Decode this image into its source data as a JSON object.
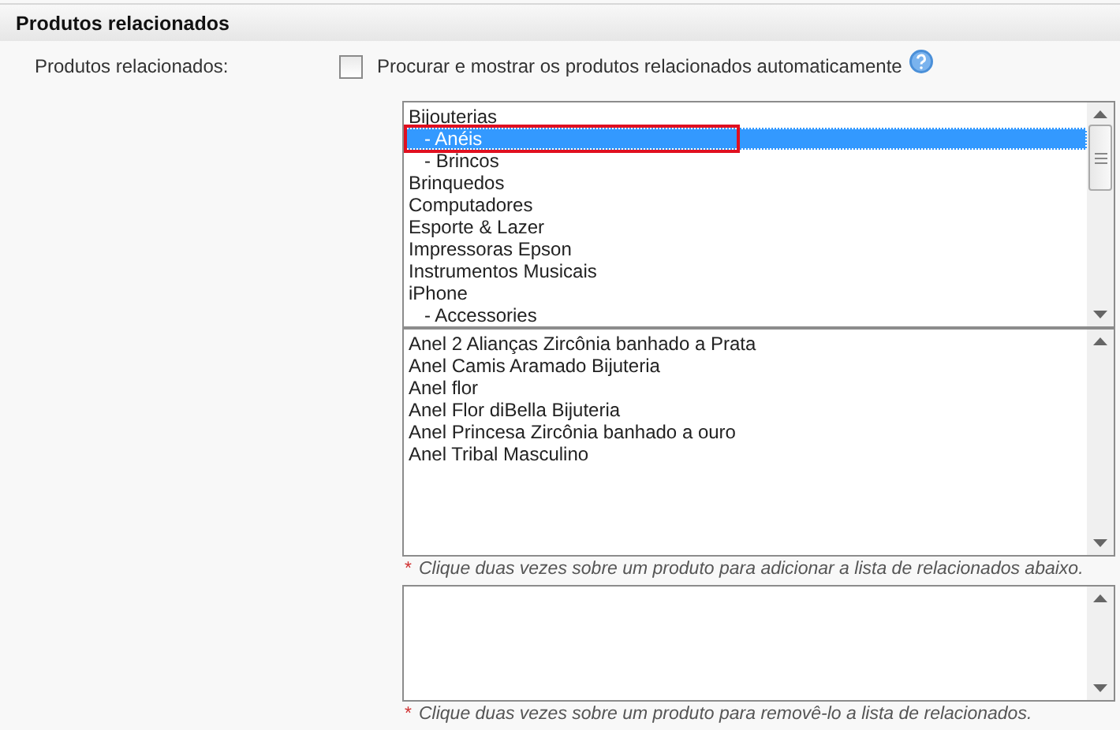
{
  "section": {
    "title": "Produtos relacionados"
  },
  "field": {
    "label": "Produtos relacionados:",
    "checkbox": {
      "label": "Procurar e mostrar os produtos relacionados automaticamente",
      "checked": false
    }
  },
  "categories": [
    {
      "label": "Bijouterias",
      "selected": false,
      "annotated": false,
      "children": [
        {
          "label": "- Anéis",
          "selected": true,
          "annotated": true
        },
        {
          "label": "- Brincos",
          "selected": false,
          "annotated": false
        }
      ]
    },
    {
      "label": "Brinquedos",
      "selected": false,
      "annotated": false
    },
    {
      "label": "Computadores",
      "selected": false,
      "annotated": false
    },
    {
      "label": "Esporte & Lazer",
      "selected": false,
      "annotated": false
    },
    {
      "label": "Impressoras Epson",
      "selected": false,
      "annotated": false
    },
    {
      "label": "Instrumentos Musicais",
      "selected": false,
      "annotated": false
    },
    {
      "label": "iPhone",
      "selected": false,
      "annotated": false,
      "children": [
        {
          "label": "- Accessories",
          "selected": false,
          "annotated": false
        }
      ]
    }
  ],
  "products": [
    {
      "label": "Anel 2 Alianças Zircônia banhado a Prata",
      "selected": false
    },
    {
      "label": "Anel Camis Aramado Bijuteria",
      "selected": false
    },
    {
      "label": "Anel flor",
      "selected": false
    },
    {
      "label": "Anel Flor diBella Bijuteria",
      "selected": false
    },
    {
      "label": "Anel Princesa Zircônia banhado a ouro",
      "selected": false
    },
    {
      "label": "Anel Tribal Masculino",
      "selected": false
    }
  ],
  "products_note": {
    "mark": "*",
    "text": "Clique duas vezes sobre um produto para adicionar a lista de relacionados abaixo."
  },
  "related_note": {
    "mark": "*",
    "text": "Clique duas vezes sobre um produto para removê-lo a lista de relacionados."
  }
}
